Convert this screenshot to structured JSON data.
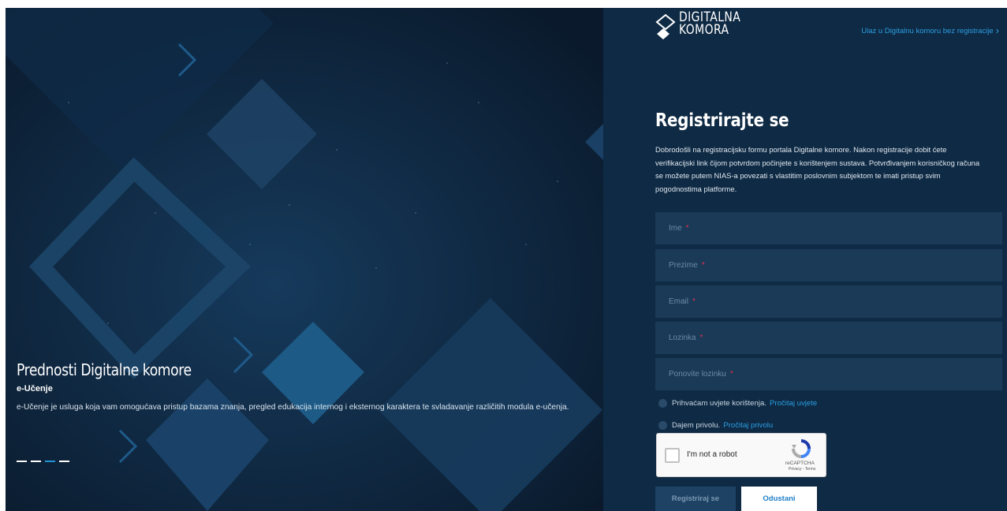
{
  "hero": {
    "heading": "Prednosti Digitalne komore",
    "subheading": "e-Učenje",
    "text": "e-Učenje je usluga koja vam omogućava pristup bazama znanja, pregled edukacija internog i eksternog karaktera te svladavanje različitih modula e-učenja.",
    "slides": [
      {
        "active": false
      },
      {
        "active": false
      },
      {
        "active": true
      },
      {
        "active": false
      }
    ]
  },
  "header": {
    "logo_line1": "DIGITALNA",
    "logo_line2": "KOMORA",
    "guest_link": "Ulaz u Digitalnu komoru bez registracije"
  },
  "form": {
    "title": "Registrirajte se",
    "intro": "Dobrodošli na registracijsku formu portala Digitalne komore. Nakon registracije dobit ćete verifikacijski link čijom potvrdom počinjete s korištenjem sustava. Potvrđivanjem korisničkog računa se možete putem NIAS-a povezati s vlastitim poslovnim subjektom te imati pristup svim pogodnostima platforme.",
    "fields": {
      "first_name": "Ime",
      "last_name": "Prezime",
      "email": "Email",
      "password": "Lozinka",
      "password_repeat": "Ponovite lozinku"
    },
    "required_mark": "*",
    "terms_label": "Prihvaćam uvjete korištenja.",
    "terms_link": "Pročitaj uvjete",
    "privacy_label": "Dajem privolu.",
    "privacy_link": "Pročitaj privolu",
    "captcha": {
      "label": "I'm not a robot",
      "brand": "reCAPTCHA",
      "terms": "Privacy - Terms"
    },
    "submit_label": "Registriraj se",
    "cancel_label": "Odustani"
  },
  "colors": {
    "accent": "#2a9ee2",
    "panel_bg": "#0f2a44",
    "field_bg": "#1a3a58",
    "required": "#e0304a"
  }
}
